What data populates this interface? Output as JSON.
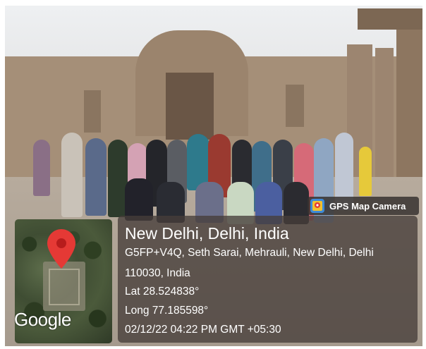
{
  "badge": {
    "icon": "gps-map-camera-icon",
    "text": "GPS Map Camera"
  },
  "location": {
    "title": "New Delhi, Delhi, India",
    "address_line1": "G5FP+V4Q, Seth Sarai, Mehrauli, New Delhi, Delhi",
    "address_line2": "110030, India",
    "lat": "Lat 28.524838°",
    "long": "Long 77.185598°",
    "datetime": "02/12/22 04:22 PM GMT +05:30"
  },
  "map": {
    "logo_text": "Google",
    "pin_color": "#e53935"
  },
  "colors": {
    "overlay": "#463e3a",
    "text": "#ffffff"
  }
}
